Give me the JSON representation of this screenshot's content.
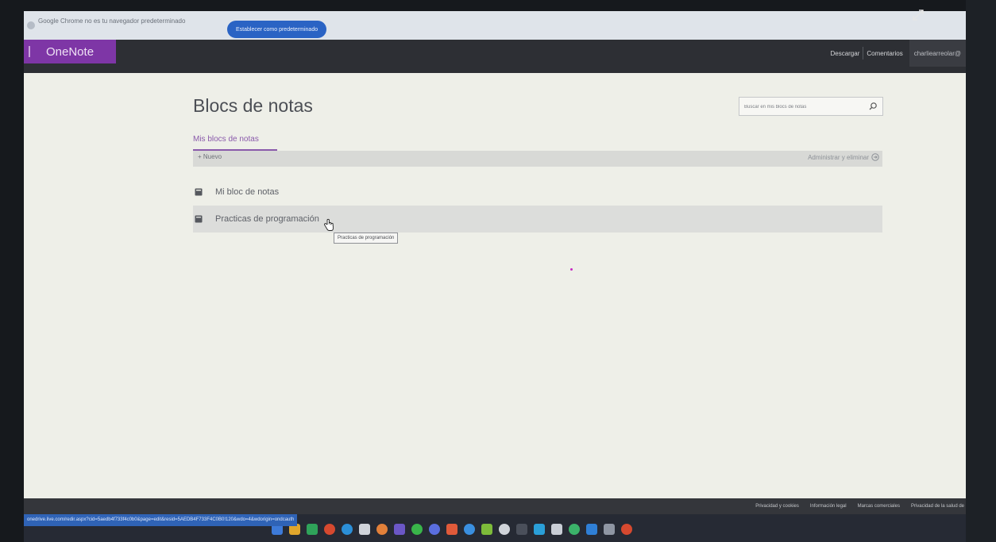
{
  "infobar": {
    "message": "Google Chrome no es tu navegador predeterminado",
    "set_default_label": "Establecer como predeterminado"
  },
  "appbar": {
    "brand": "OneNote",
    "download_label": "Descargar",
    "comments_label": "Comentarios",
    "user": "charliearreolar@"
  },
  "main": {
    "title": "Blocs de notas",
    "search_placeholder": "Buscar en mis blocs de notas",
    "tab_mine": "Mis blocs de notas",
    "new_label": "+ Nuevo",
    "manage_label": "Administrar y eliminar",
    "notebooks": [
      {
        "label": "Mi bloc de notas"
      },
      {
        "label": "Practicas de programación"
      }
    ],
    "tooltip": "Practicas de programación"
  },
  "footer": {
    "links": [
      "Privacidad y cookies",
      "Información legal",
      "Marcas comerciales",
      "Privacidad de la salud de"
    ]
  },
  "status_url": "onedrive.live.com/redir.aspx?cid=5aedb4f733f4c0b0&page=edit&resid=5AEDB4F733F4C0B0!120&wdo=4&wdorigin=ondcauth",
  "colors": {
    "brand_purple": "#7e36a6",
    "header_dark": "#2d2f34",
    "chrome_button_blue": "#2a63c4",
    "tab_purple": "#8a5aab"
  }
}
